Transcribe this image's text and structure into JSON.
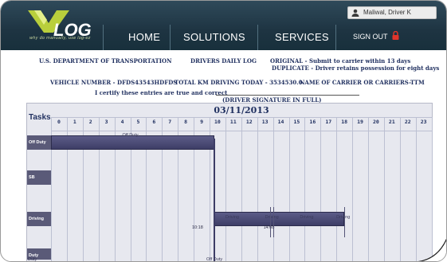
{
  "header": {
    "logo_text": "why do manually, use log-ez",
    "nav": [
      "HOME",
      "SOLUTIONS",
      "SERVICES"
    ],
    "signout_label": "SIGN OUT",
    "user_name": "Maliwal, Driver K"
  },
  "form": {
    "dept": "U.S. DEPARTMENT OF TRANSPORTATION",
    "log_title": "DRIVERS DAILY LOG",
    "original": "ORIGINAL - Submit to carrier within 13 days",
    "duplicate": "DUPLICATE - Driver retains possession for eight days",
    "vehicle": "VEHICLE NUMBER - DFDS43543HDFDS",
    "total_km": "TOTAL KM DRIVING TODAY - 3534530.0",
    "carrier": "NAME OF CARRIER OR CARRIERS-TTM",
    "certify": "I certify these entries are true and correct",
    "signature": "(DRIVER SIGNATURE IN FULL)"
  },
  "chart_data": {
    "type": "gantt",
    "title": "03/11/2013",
    "tasks_header": "Tasks",
    "hours": [
      "0",
      "1",
      "2",
      "3",
      "4",
      "5",
      "6",
      "7",
      "8",
      "9",
      "10",
      "11",
      "12",
      "13",
      "14",
      "15",
      "16",
      "17",
      "18",
      "19",
      "20",
      "21",
      "22",
      "23"
    ],
    "rows": [
      "Off Duty",
      "SB",
      "Driving",
      "Duty"
    ],
    "segments": [
      {
        "task": "Off Duty",
        "start_hour": 0,
        "end_hour": 10.3,
        "label": "Off Duty"
      },
      {
        "task": "Driving",
        "start_hour": 10.3,
        "end_hour": 18.5,
        "label": "Driving"
      }
    ],
    "annotations": [
      {
        "hour": 11.5,
        "text": "Driving"
      },
      {
        "hour": 14,
        "text": "Driving"
      },
      {
        "hour": 16.2,
        "text": "Driving"
      },
      {
        "hour": 18.5,
        "text": "Driving"
      },
      {
        "hour": 10,
        "text": "10:18"
      },
      {
        "hour": 13.8,
        "text": "14:08"
      },
      {
        "hour": 10,
        "text": "Off Duty"
      },
      {
        "hour": 0,
        "text": "Duty"
      }
    ]
  }
}
